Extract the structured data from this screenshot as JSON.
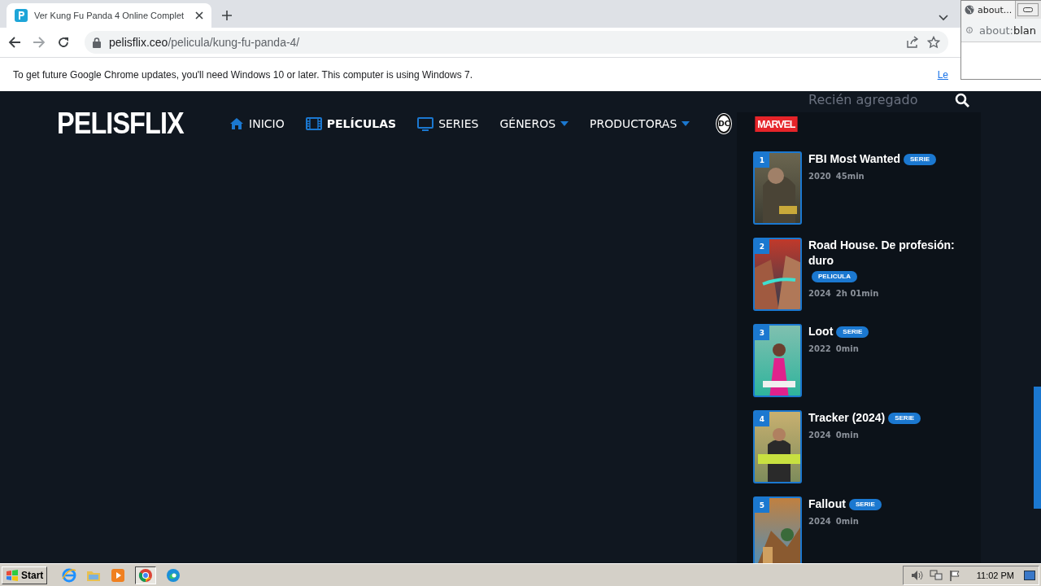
{
  "browser": {
    "tab": {
      "title": "Ver Kung Fu Panda 4 Online Complet",
      "selected": true
    },
    "url_host": "pelisflix.ceo",
    "url_path": "/pelicula/kung-fu-panda-4/"
  },
  "infobar": {
    "message": "To get future Google Chrome updates, you'll need Windows 10 or later. This computer is using Windows 7.",
    "link": "Le"
  },
  "popup": {
    "tab_title": "about...",
    "url_scheme": "about:",
    "url_rest": "blan"
  },
  "site": {
    "logo": "PELISFLIX",
    "nav": [
      {
        "kind": "home",
        "label": "INICIO",
        "selected": false
      },
      {
        "kind": "film",
        "label": "PELÍCULAS",
        "selected": true
      },
      {
        "kind": "tv",
        "label": "SERIES",
        "selected": false
      },
      {
        "kind": "dropdown",
        "label": "GÉNEROS",
        "selected": false
      },
      {
        "kind": "dropdown",
        "label": "PRODUCTORAS",
        "selected": false
      },
      {
        "kind": "dc",
        "label": "DC",
        "selected": false
      },
      {
        "kind": "marvel",
        "label": "MARVEL",
        "selected": false
      }
    ],
    "search": {
      "placeholder": "Recién agregado"
    },
    "recent": [
      {
        "rank": "1",
        "title": "FBI Most Wanted",
        "type": "SERIE",
        "year": "2020",
        "duration": "45min"
      },
      {
        "rank": "2",
        "title": "Road House. De profesión: duro",
        "type": "PELICULA",
        "year": "2024",
        "duration": "2h 01min"
      },
      {
        "rank": "3",
        "title": "Loot",
        "type": "SERIE",
        "year": "2022",
        "duration": "0min"
      },
      {
        "rank": "4",
        "title": "Tracker (2024)",
        "type": "SERIE",
        "year": "2024",
        "duration": "0min"
      },
      {
        "rank": "5",
        "title": "Fallout",
        "type": "SERIE",
        "year": "2024",
        "duration": "0min"
      }
    ]
  },
  "taskbar": {
    "start": "Start",
    "clock": "11:02 PM"
  }
}
